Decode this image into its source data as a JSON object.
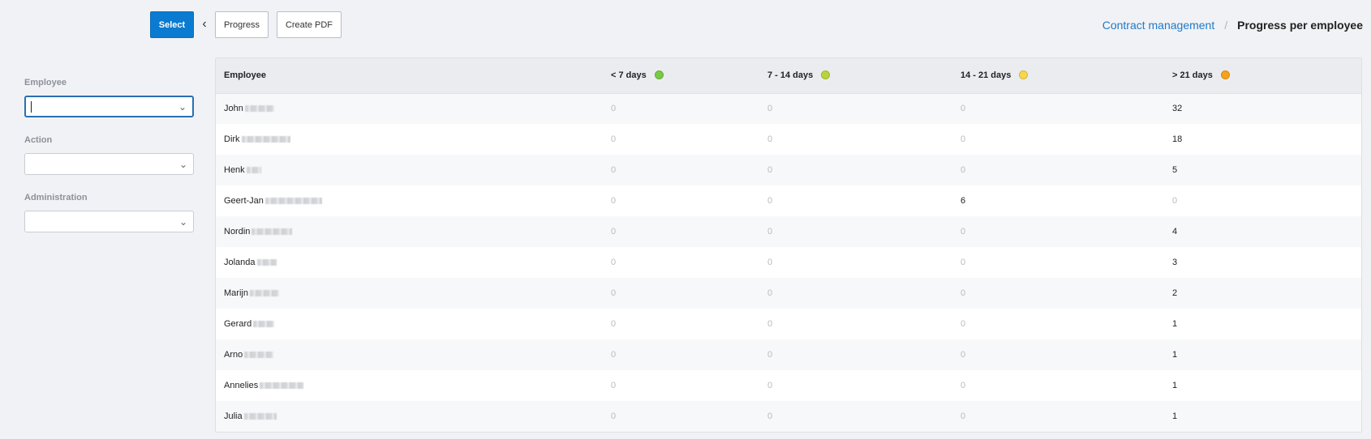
{
  "toolbar": {
    "select_label": "Select",
    "progress_label": "Progress",
    "create_pdf_label": "Create PDF"
  },
  "breadcrumb": {
    "link": "Contract management",
    "separator": "/",
    "current": "Progress per employee"
  },
  "filters": {
    "employee_label": "Employee",
    "employee_value": "",
    "action_label": "Action",
    "action_value": "",
    "administration_label": "Administration",
    "administration_value": ""
  },
  "table": {
    "columns": [
      {
        "label": "Employee"
      },
      {
        "label": "< 7 days",
        "dot_color": "#7ac943"
      },
      {
        "label": "7 - 14 days",
        "dot_color": "#b9d43b"
      },
      {
        "label": "14 - 21 days",
        "dot_color": "#f7d84a"
      },
      {
        "label": "> 21 days",
        "dot_color": "#f7a21b"
      }
    ],
    "rows": [
      {
        "name": "John",
        "blur_w": 36,
        "values": [
          "0",
          "0",
          "0",
          "32"
        ]
      },
      {
        "name": "Dirk",
        "blur_w": 60,
        "values": [
          "0",
          "0",
          "0",
          "18"
        ]
      },
      {
        "name": "Henk",
        "blur_w": 18,
        "values": [
          "0",
          "0",
          "0",
          "5"
        ]
      },
      {
        "name": "Geert-Jan",
        "blur_w": 70,
        "values": [
          "0",
          "0",
          "6",
          "0"
        ]
      },
      {
        "name": "Nordin",
        "blur_w": 50,
        "values": [
          "0",
          "0",
          "0",
          "4"
        ]
      },
      {
        "name": "Jolanda",
        "blur_w": 24,
        "values": [
          "0",
          "0",
          "0",
          "3"
        ]
      },
      {
        "name": "Marijn",
        "blur_w": 36,
        "values": [
          "0",
          "0",
          "0",
          "2"
        ]
      },
      {
        "name": "Gerard",
        "blur_w": 26,
        "values": [
          "0",
          "0",
          "0",
          "1"
        ]
      },
      {
        "name": "Arno",
        "blur_w": 36,
        "values": [
          "0",
          "0",
          "0",
          "1"
        ]
      },
      {
        "name": "Annelies",
        "blur_w": 54,
        "values": [
          "0",
          "0",
          "0",
          "1"
        ]
      },
      {
        "name": "Julia",
        "blur_w": 40,
        "values": [
          "0",
          "0",
          "0",
          "1"
        ]
      }
    ]
  },
  "colors": {
    "accent": "#0a7bd0",
    "link": "#1f7ac7"
  }
}
